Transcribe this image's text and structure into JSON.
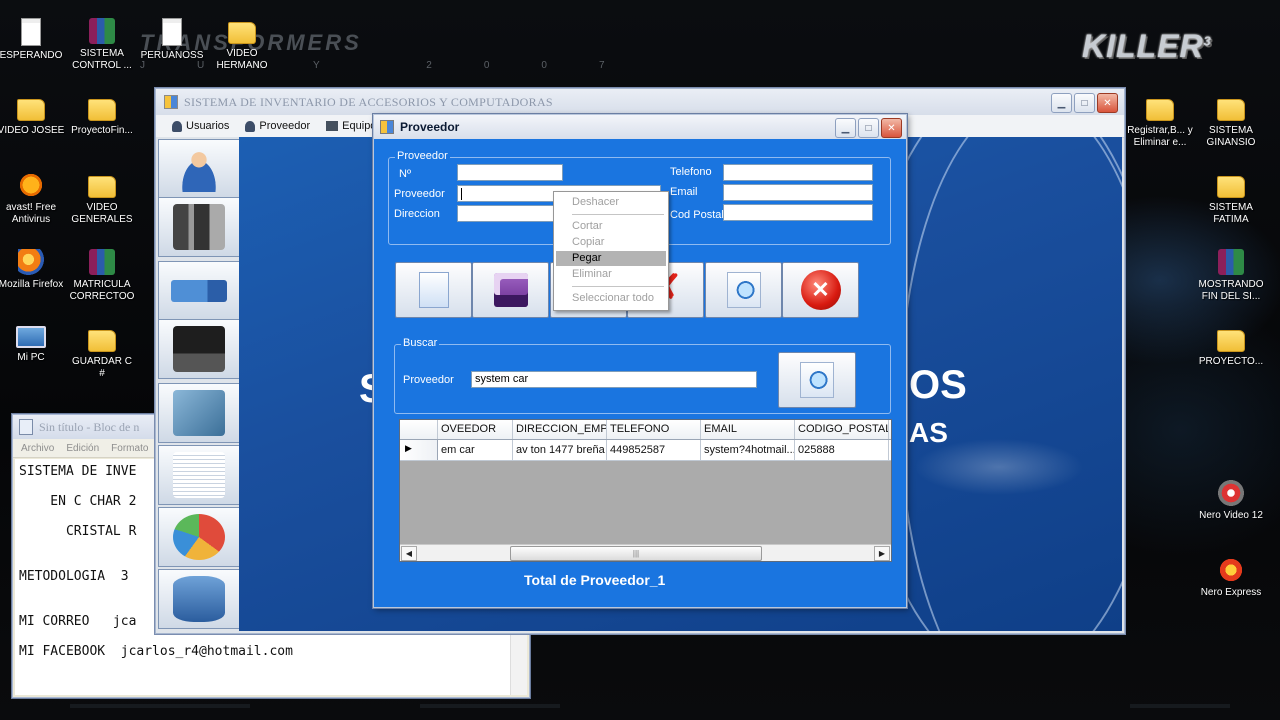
{
  "desktop": {
    "wallpaper_text": "TRANSFORMERS",
    "wallpaper_subtext": "JULY 2007",
    "logo_text": "KILLER",
    "logo_sup": "3",
    "icons": [
      {
        "label": "ESPERANDO"
      },
      {
        "label": "SISTEMA CONTROL ..."
      },
      {
        "label": "PERUANOSS"
      },
      {
        "label": "VIDEO HERMANO"
      },
      {
        "label": "VIDEO JOSEE"
      },
      {
        "label": "ProyectoFin..."
      },
      {
        "label": "avast! Free Antivirus"
      },
      {
        "label": "VIDEO GENERALES"
      },
      {
        "label": "Mozilla Firefox"
      },
      {
        "label": "MATRICULA CORRECTOO"
      },
      {
        "label": "Mi PC"
      },
      {
        "label": "GUARDAR C #"
      },
      {
        "label": "Registrar,B... y Eliminar e..."
      },
      {
        "label": "SISTEMA GINANSIO"
      },
      {
        "label": "SISTEMA FATIMA"
      },
      {
        "label": "MOSTRANDO FIN DEL SI..."
      },
      {
        "label": "PROYECTO..."
      },
      {
        "label": "Nero Video 12"
      },
      {
        "label": "Nero Express"
      }
    ]
  },
  "notepad": {
    "title": "Sin título - Bloc de n",
    "menu": [
      "Archivo",
      "Edición",
      "Formato"
    ],
    "lines": [
      "SISTEMA DE INVE",
      "    EN C CHAR 2",
      "      CRISTAL R",
      "METODOLOGIA  3",
      "MI CORREO   jca",
      "MI FACEBOOK  jcarlos_r4@hotmail.com"
    ]
  },
  "main_window": {
    "title": "SISTEMA DE INVENTARIO DE ACCESORIOS Y  COMPUTADORAS",
    "menu": [
      {
        "label": "Usuarios"
      },
      {
        "label": "Proveedor"
      },
      {
        "label": "Equipo"
      }
    ],
    "bg_text_1": "S",
    "bg_text_2": "OS",
    "bg_text_3": "AS"
  },
  "proveedor_form": {
    "title": "Proveedor",
    "group_label": "Proveedor",
    "labels": {
      "numero": "Nº",
      "proveedor": "Proveedor",
      "direccion": "Direccion",
      "telefono": "Telefono",
      "email": "Email",
      "cod_postal": "Cod Postal"
    },
    "values": {
      "numero": "",
      "proveedor": "",
      "direccion": "",
      "telefono": "",
      "email": "",
      "cod_postal": ""
    },
    "context_menu": {
      "items": [
        {
          "label": "Deshacer",
          "enabled": false
        },
        {
          "label": "Cortar",
          "enabled": false
        },
        {
          "label": "Copiar",
          "enabled": false
        },
        {
          "label": "Pegar",
          "enabled": true,
          "highlighted": true
        },
        {
          "label": "Eliminar",
          "enabled": false
        },
        {
          "label": "Seleccionar todo",
          "enabled": false
        }
      ]
    },
    "buscar": {
      "group_label": "Buscar",
      "label": "Proveedor",
      "value": "system car"
    },
    "grid": {
      "columns": [
        "OVEEDOR",
        "DIRECCION_EMPR",
        "TELEFONO",
        "EMAIL",
        "CODIGO_POSTAL"
      ],
      "rows": [
        [
          "em car",
          "av ton 1477 breña",
          "449852587",
          "system?4hotmail....",
          "025888"
        ]
      ],
      "row_marker": "▶"
    },
    "total_label": "Total de Proveedor_1"
  },
  "colors": {
    "form_bg": "#1a75e0",
    "mdi_bg": "#1a4f9e",
    "close_red": "#d9553c"
  }
}
